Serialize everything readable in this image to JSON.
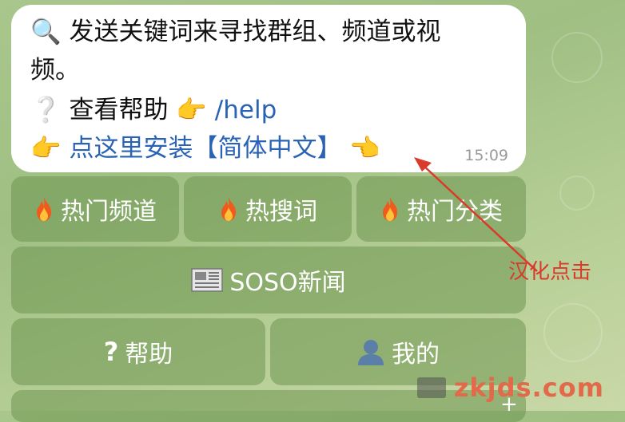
{
  "message": {
    "line1": "🔍 发送关键词来寻找群组、频道或视",
    "line2": "频。",
    "line3_icon": "❔",
    "line3_text": " 查看帮助 ",
    "line3_point": "👉",
    "line3_link": "/help",
    "line4_point_left": "👉",
    "line4_link": "点这里安装【简体中文】",
    "line4_point_right": "👈",
    "time": "15:09"
  },
  "keyboard": {
    "hot_channels": "热门频道",
    "hot_search": "热搜词",
    "hot_categories": "热门分类",
    "news": "SOSO新闻",
    "help": "帮助",
    "mine": "我的"
  },
  "icons": {
    "hot_channels": "fire-icon",
    "hot_search": "fire-icon",
    "hot_categories": "fire-icon",
    "news": "newspaper-icon",
    "help": "question-mark-icon",
    "mine": "user-silhouette-icon"
  },
  "annotation": {
    "label": "汉化点击",
    "color": "#d93a2b"
  },
  "watermark": {
    "text": "zkjds.com"
  }
}
